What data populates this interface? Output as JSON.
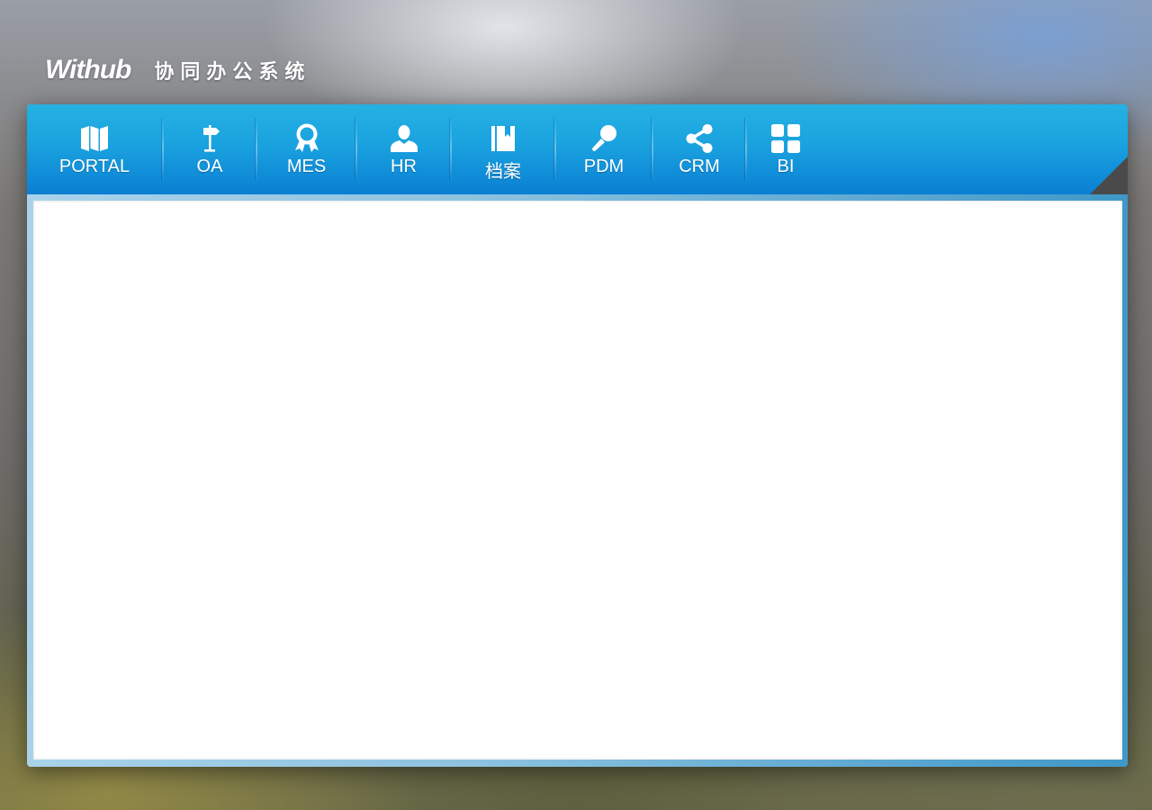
{
  "header": {
    "logo": "Withub",
    "title": "协同办公系统"
  },
  "nav": {
    "items": [
      {
        "label": "PORTAL",
        "icon": "map-icon"
      },
      {
        "label": "OA",
        "icon": "signpost-icon"
      },
      {
        "label": "MES",
        "icon": "award-ribbon-icon"
      },
      {
        "label": "HR",
        "icon": "user-icon"
      },
      {
        "label": "档案",
        "icon": "book-icon"
      },
      {
        "label": "PDM",
        "icon": "microphone-icon"
      },
      {
        "label": "CRM",
        "icon": "share-icon"
      },
      {
        "label": "BI",
        "icon": "grid-icon"
      }
    ]
  },
  "colors": {
    "nav_top": "#25b1e3",
    "nav_bottom": "#0a7fd3",
    "content_bg": "#ffffff"
  }
}
